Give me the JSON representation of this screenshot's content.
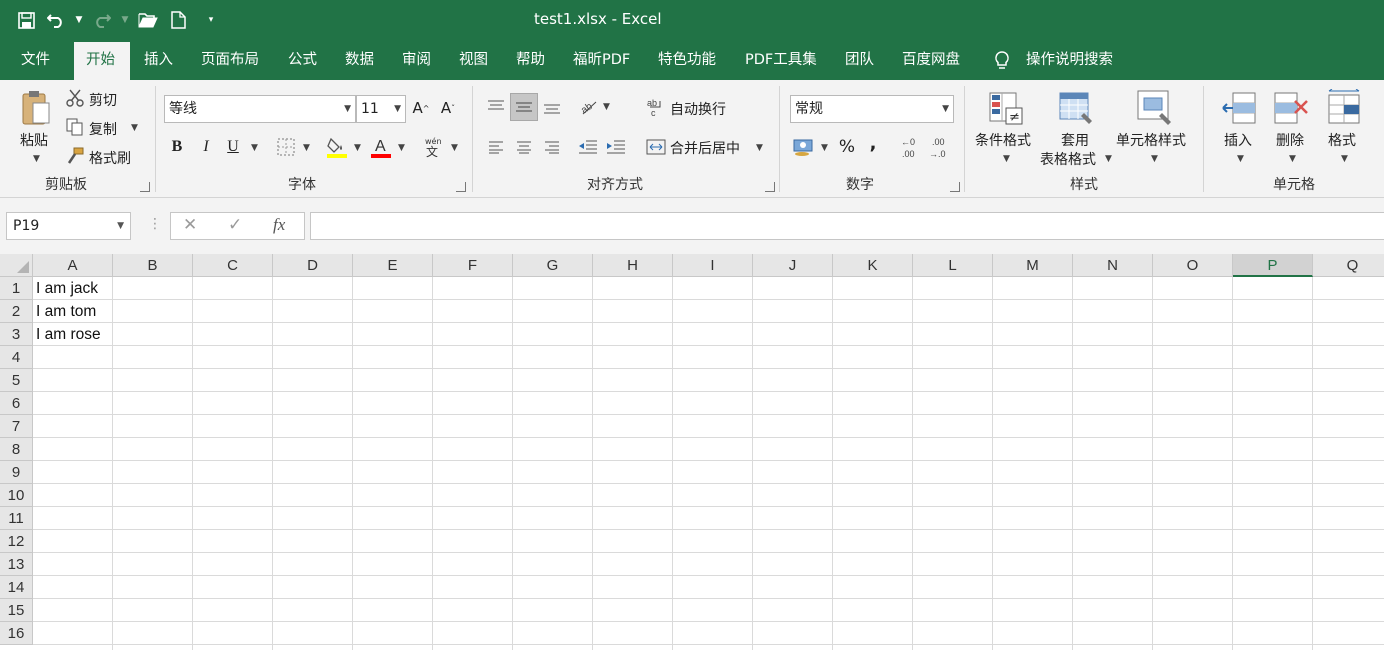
{
  "window": {
    "title": "test1.xlsx  -  Excel"
  },
  "qat": {
    "icons": [
      "save-icon",
      "undo-icon",
      "redo-icon",
      "open-icon",
      "new-file-icon",
      "customize-icon"
    ]
  },
  "tabs": [
    {
      "label": "文件",
      "active": false
    },
    {
      "label": "开始",
      "active": true
    },
    {
      "label": "插入",
      "active": false
    },
    {
      "label": "页面布局",
      "active": false
    },
    {
      "label": "公式",
      "active": false
    },
    {
      "label": "数据",
      "active": false
    },
    {
      "label": "审阅",
      "active": false
    },
    {
      "label": "视图",
      "active": false
    },
    {
      "label": "帮助",
      "active": false
    },
    {
      "label": "福昕PDF",
      "active": false
    },
    {
      "label": "特色功能",
      "active": false
    },
    {
      "label": "PDF工具集",
      "active": false
    },
    {
      "label": "团队",
      "active": false
    },
    {
      "label": "百度网盘",
      "active": false
    }
  ],
  "tell_me": "操作说明搜索",
  "ribbon": {
    "clipboard": {
      "paste": "粘贴",
      "cut": "剪切",
      "copy": "复制",
      "format_painter": "格式刷",
      "label": "剪贴板"
    },
    "font": {
      "name": "等线",
      "size": "11",
      "bold": "B",
      "italic": "I",
      "underline": "U",
      "label": "字体"
    },
    "alignment": {
      "wrap": "自动换行",
      "merge": "合并后居中",
      "label": "对齐方式"
    },
    "number": {
      "format": "常规",
      "percent": "%",
      "comma": ",",
      "label": "数字"
    },
    "styles": {
      "conditional": "条件格式",
      "table_line1": "套用",
      "table_line2": "表格格式",
      "cell_styles": "单元格样式",
      "label": "样式"
    },
    "cells": {
      "insert": "插入",
      "delete": "删除",
      "format": "格式",
      "label": "单元格"
    }
  },
  "formula_bar": {
    "name_box": "P19",
    "fx": "fx",
    "value": ""
  },
  "sheet": {
    "columns": [
      "A",
      "B",
      "C",
      "D",
      "E",
      "F",
      "G",
      "H",
      "I",
      "J",
      "K",
      "L",
      "M",
      "N",
      "O",
      "P",
      "Q"
    ],
    "selected_column": "P",
    "rows": [
      "1",
      "2",
      "3",
      "4",
      "5",
      "6",
      "7",
      "8",
      "9",
      "10",
      "11",
      "12",
      "13",
      "14",
      "15",
      "16"
    ],
    "cells": {
      "A1": "I am jack",
      "A2": "I am tom",
      "A3": "I am rose"
    }
  },
  "colors": {
    "brand": "#217346",
    "underline_fill": "#ffff00",
    "font_color": "#ff0000"
  }
}
